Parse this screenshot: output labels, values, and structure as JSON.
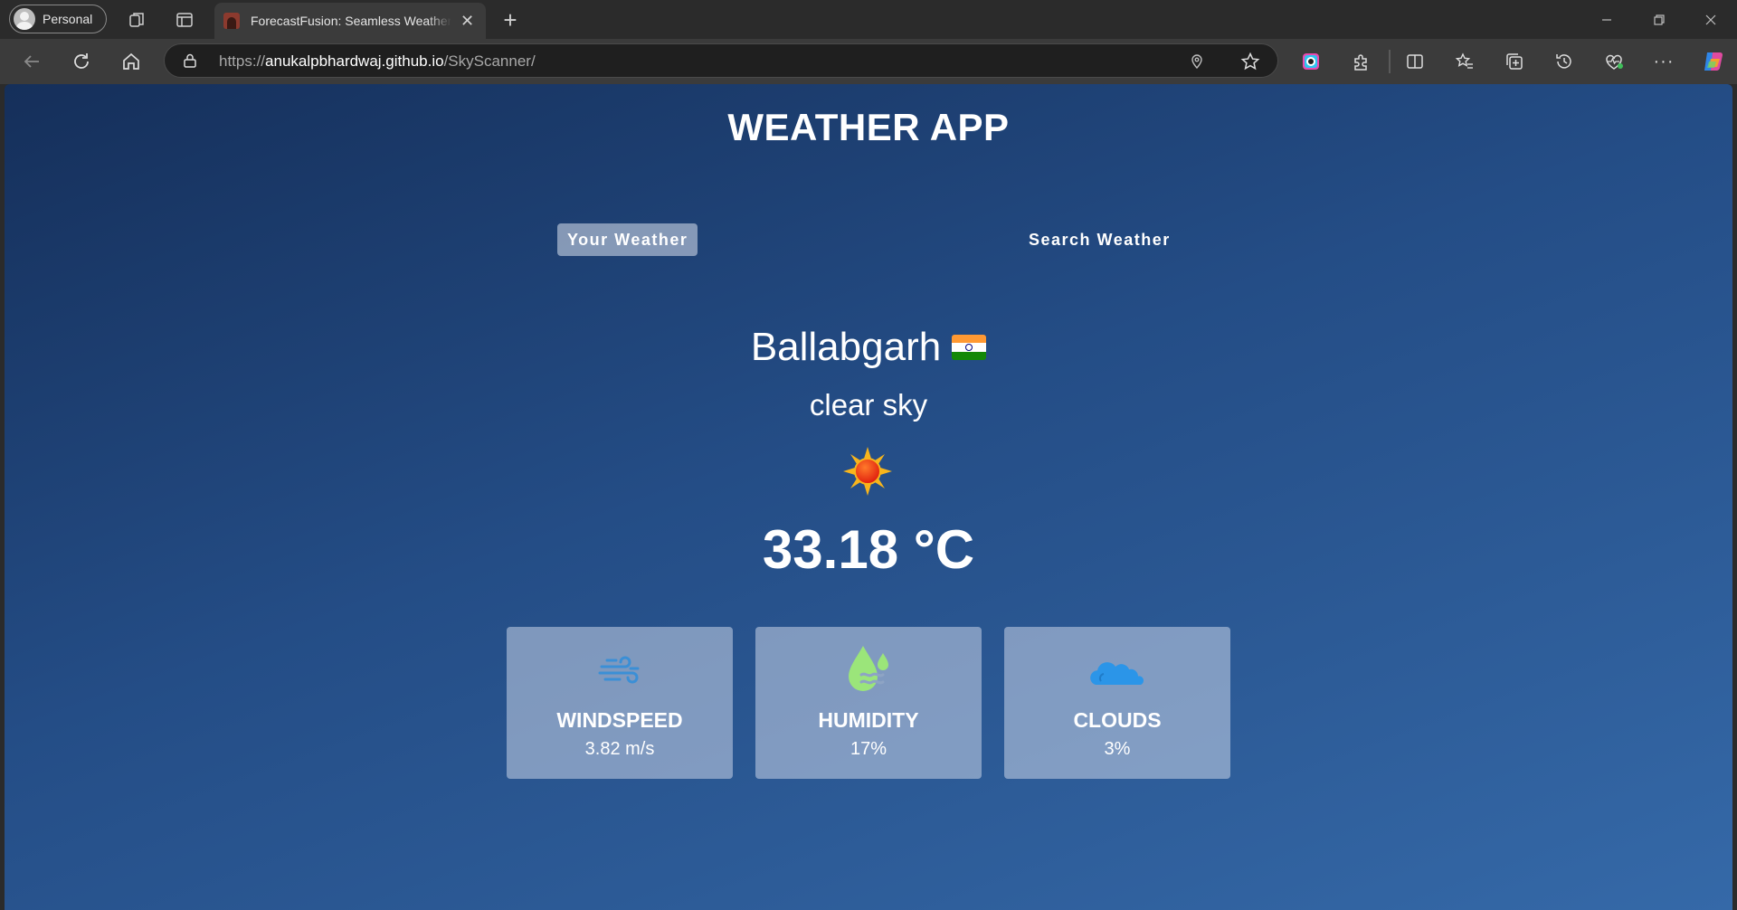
{
  "browser": {
    "profile_label": "Personal",
    "tab_title": "ForecastFusion: Seamless Weather Tracking",
    "url_prefix": "https://",
    "url_host": "anukalpbhardwaj.github.io",
    "url_path": "/SkyScanner/"
  },
  "app": {
    "title": "WEATHER APP",
    "tabs": [
      {
        "label": "Your Weather",
        "active": true
      },
      {
        "label": "Search Weather",
        "active": false
      }
    ],
    "city": "Ballabgarh",
    "country_flag": "india-flag-icon",
    "description": "clear sky",
    "weather_icon": "sun-icon",
    "temperature": "33.18 °C",
    "cards": [
      {
        "label": "WINDSPEED",
        "value": "3.82 m/s",
        "icon": "wind-icon"
      },
      {
        "label": "HUMIDITY",
        "value": "17%",
        "icon": "humidity-icon"
      },
      {
        "label": "CLOUDS",
        "value": "3%",
        "icon": "cloud-icon"
      }
    ]
  },
  "colors": {
    "page_gradient_start": "#152f5a",
    "page_gradient_end": "#3569a8",
    "active_tab_bg": "#9aa9c2",
    "wind_icon": "#3b8fd6",
    "humidity_icon": "#9be57a",
    "cloud_icon": "#2b95e8"
  }
}
